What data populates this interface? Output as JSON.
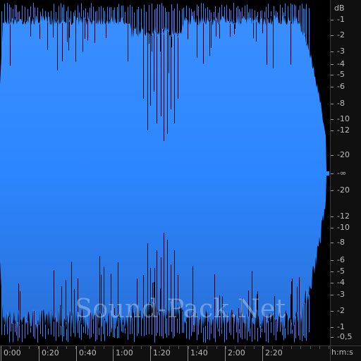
{
  "db_scale": {
    "unit": "dB",
    "upper_ticks": [
      "-1",
      "-2",
      "-3",
      "-4",
      "-5",
      "-6",
      "-8",
      "-10",
      "-12",
      "-20"
    ],
    "center_label": "-∞",
    "lower_ticks": [
      "-20",
      "-12",
      "-10",
      "-8",
      "-6",
      "-5",
      "-4",
      "-3",
      "-2",
      "-1",
      "-0,5"
    ]
  },
  "time_scale": {
    "unit": "h:m:s",
    "ticks": [
      "0:00",
      "0:20",
      "0:40",
      "1:00",
      "1:20",
      "1:40",
      "2:00",
      "2:20"
    ]
  },
  "watermark": "Sound-Pack.Net",
  "colors": {
    "waveform": "#2e86ff",
    "background": "#000000",
    "ruler_text": "#bdbdbd"
  },
  "waveform": {
    "channels": "mono",
    "dense_band_fraction": 0.9,
    "dip_region_fraction": 0.55,
    "fade_out": true
  }
}
